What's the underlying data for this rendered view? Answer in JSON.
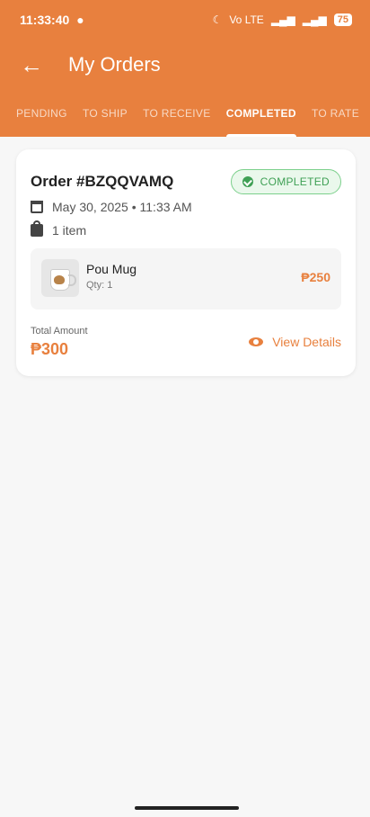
{
  "status_bar": {
    "time": "11:33:40",
    "battery": "75",
    "network_label": "Vo LTE"
  },
  "appbar": {
    "back_icon": "arrow-left-icon",
    "title": "My Orders"
  },
  "tabs": [
    {
      "label": "PENDING",
      "active": false
    },
    {
      "label": "TO SHIP",
      "active": false
    },
    {
      "label": "TO RECEIVE",
      "active": false
    },
    {
      "label": "COMPLETED",
      "active": true
    },
    {
      "label": "TO RATE",
      "active": false
    }
  ],
  "order": {
    "id": "Order #BZQQVAMQ",
    "status": "COMPLETED",
    "date": "May 30, 2025 • 11:33 AM",
    "items_count": "1 item",
    "items": [
      {
        "name": "Pou Mug",
        "qty": "Qty: 1",
        "price": "₱250"
      }
    ],
    "total_label": "Total Amount",
    "total_value": "₱300",
    "view_details_label": "View Details"
  },
  "colors": {
    "primary": "#e8803e",
    "success": "#3fa055",
    "background": "#f7f7f7"
  }
}
